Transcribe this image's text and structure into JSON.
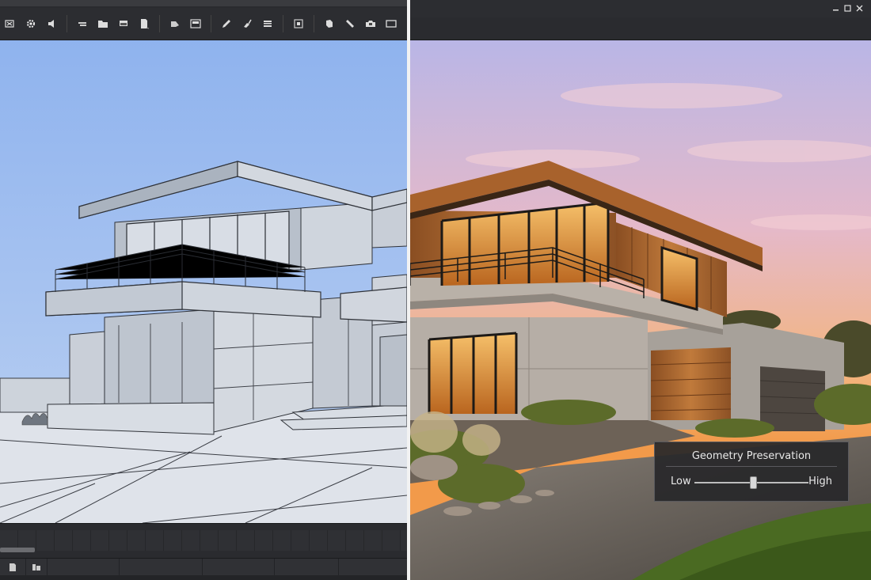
{
  "toolbar": {
    "tools": [
      {
        "icon": "shrink-icon"
      },
      {
        "icon": "gear-icon"
      },
      {
        "icon": "speaker-icon"
      },
      {
        "icon": "layer-icon"
      },
      {
        "icon": "folder-icon"
      },
      {
        "icon": "window-icon"
      },
      {
        "icon": "page-icon"
      },
      {
        "icon": "tag-icon"
      },
      {
        "icon": "image-icon"
      },
      {
        "icon": "pencil-icon"
      },
      {
        "icon": "brush-icon"
      },
      {
        "icon": "list-icon"
      },
      {
        "icon": "frame-icon"
      },
      {
        "icon": "cube-icon"
      },
      {
        "icon": "ruler-icon"
      },
      {
        "icon": "camera-icon"
      },
      {
        "icon": "screen-icon"
      }
    ]
  },
  "geometry_panel": {
    "title": "Geometry Preservation",
    "low_label": "Low",
    "high_label": "High",
    "value": 0.52
  },
  "colors": {
    "divider": "#f2f2f2",
    "panel_bg": "#28282a",
    "sky_left": "#9ab9ee"
  }
}
